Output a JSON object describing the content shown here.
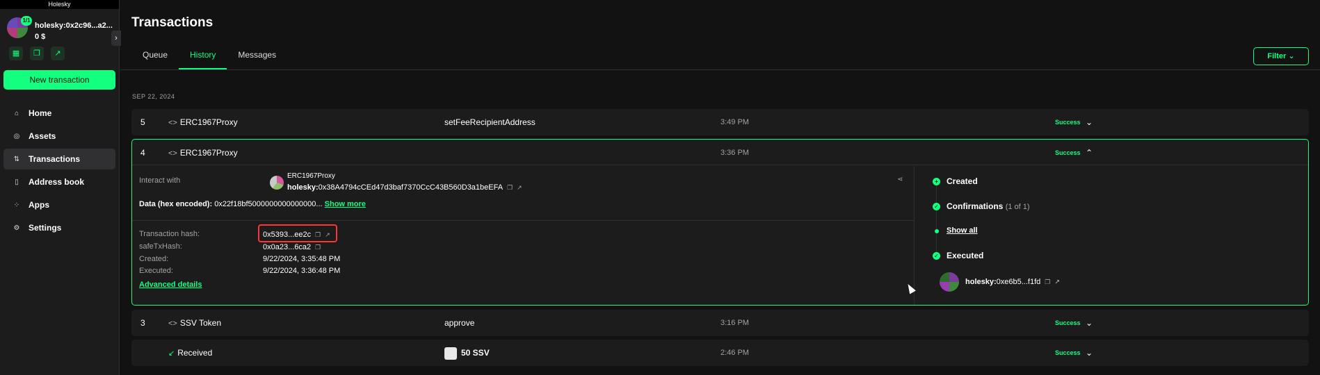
{
  "network": "Holesky",
  "safe": {
    "name": "holesky:0x2c96...a2...",
    "threshold": "1/1",
    "balance": "0 $"
  },
  "sidebar": {
    "new_transaction": "New transaction",
    "items": [
      {
        "label": "Home",
        "icon": "home-icon"
      },
      {
        "label": "Assets",
        "icon": "assets-icon"
      },
      {
        "label": "Transactions",
        "icon": "transactions-icon"
      },
      {
        "label": "Address book",
        "icon": "address-book-icon"
      },
      {
        "label": "Apps",
        "icon": "apps-icon"
      },
      {
        "label": "Settings",
        "icon": "settings-icon"
      }
    ]
  },
  "page": {
    "title": "Transactions",
    "tabs": [
      "Queue",
      "History",
      "Messages"
    ],
    "filter_label": "Filter",
    "date_label": "SEP 22, 2024"
  },
  "transactions": [
    {
      "nonce": "5",
      "info": "ERC1967Proxy",
      "method": "setFeeRecipientAddress",
      "time": "3:49 PM",
      "status": "Success"
    },
    {
      "nonce": "4",
      "info": "ERC1967Proxy",
      "method": "",
      "time": "3:36 PM",
      "status": "Success"
    },
    {
      "nonce": "3",
      "info": "SSV Token",
      "method": "approve",
      "time": "3:16 PM",
      "status": "Success"
    },
    {
      "nonce": "",
      "info": "Received",
      "method": "50 SSV",
      "time": "2:46 PM",
      "status": "Success"
    }
  ],
  "expanded": {
    "interact_label": "Interact with",
    "contract_name": "ERC1967Proxy",
    "contract_prefix": "holesky:",
    "contract_address": "0x38A4794cCEd47d3baf7370CcC43B560D3a1beEFA",
    "data_label": "Data (hex encoded):",
    "data_value": "0x22f18bf5000000000000000...",
    "show_more": "Show more",
    "tx_hash_label": "Transaction hash:",
    "tx_hash": "0x5393...ee2c",
    "safe_tx_hash_label": "safeTxHash:",
    "safe_tx_hash": "0x0a23...6ca2",
    "created_label": "Created:",
    "created": "9/22/2024, 3:35:48 PM",
    "executed_label": "Executed:",
    "executed": "9/22/2024, 3:36:48 PM",
    "advanced": "Advanced details"
  },
  "timeline": {
    "created": "Created",
    "confirmations": "Confirmations",
    "confirmations_count": "(1 of 1)",
    "show_all": "Show all",
    "executed": "Executed",
    "signer_prefix": "holesky:",
    "signer": "0xe6b5...f1fd"
  }
}
